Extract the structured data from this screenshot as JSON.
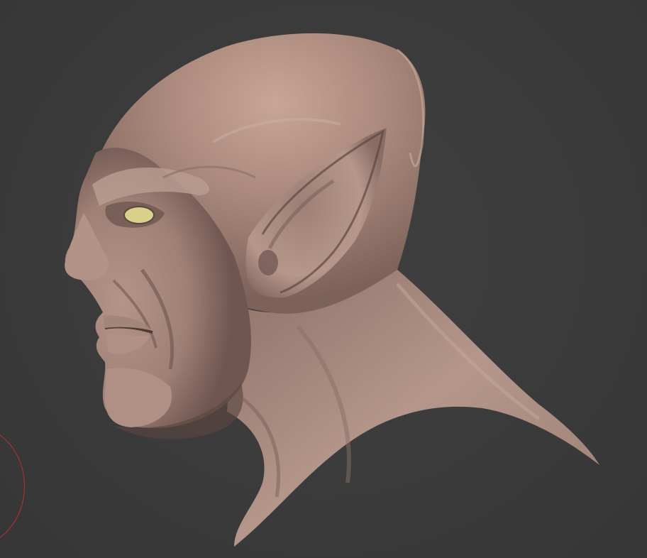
{
  "viewport": {
    "background_color": "#3a3a3a"
  },
  "model": {
    "subject": "elf-head-sculpt",
    "clay_color": "#a8887c",
    "eye_color": "#d9d18a"
  },
  "cursor": {
    "icon": "brush-circle-icon",
    "color": "#b83030"
  }
}
